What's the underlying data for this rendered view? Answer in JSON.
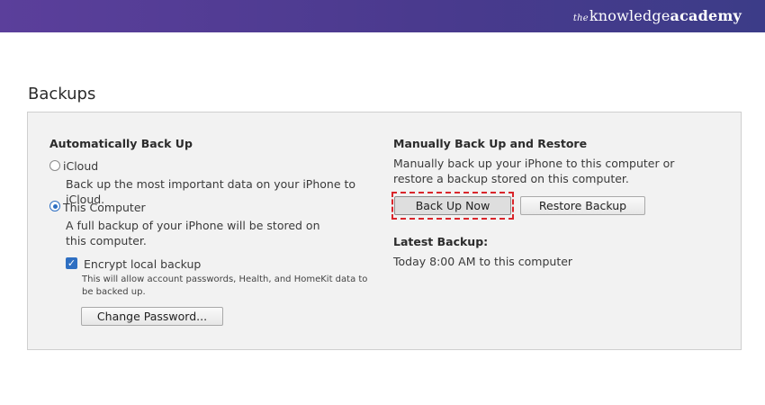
{
  "brand": {
    "prefix": "the",
    "name_part1": "knowledge",
    "name_part2": "academy"
  },
  "page_title": "Backups",
  "auto_backup": {
    "heading": "Automatically Back Up",
    "icloud": {
      "label": "iCloud",
      "description": "Back up the most important data on your iPhone to iCloud.",
      "selected": false
    },
    "this_computer": {
      "label": "This Computer",
      "description": "A full backup of your iPhone will be stored on this computer.",
      "selected": true
    },
    "encrypt": {
      "label": "Encrypt local backup",
      "checked": true,
      "note": "This will allow account passwords, Health, and HomeKit data to be backed up."
    },
    "change_password_label": "Change Password..."
  },
  "manual_backup": {
    "heading": "Manually Back Up and Restore",
    "description": "Manually back up your iPhone to this computer or restore a backup stored on this computer.",
    "back_up_now_label": "Back Up Now",
    "restore_backup_label": "Restore Backup"
  },
  "latest_backup": {
    "heading": "Latest Backup:",
    "value": "Today 8:00 AM to this computer"
  },
  "colors": {
    "banner_start": "#5b3f9b",
    "banner_end": "#3c3c88",
    "accent": "#2e6fc2",
    "highlight": "#d9252b"
  }
}
